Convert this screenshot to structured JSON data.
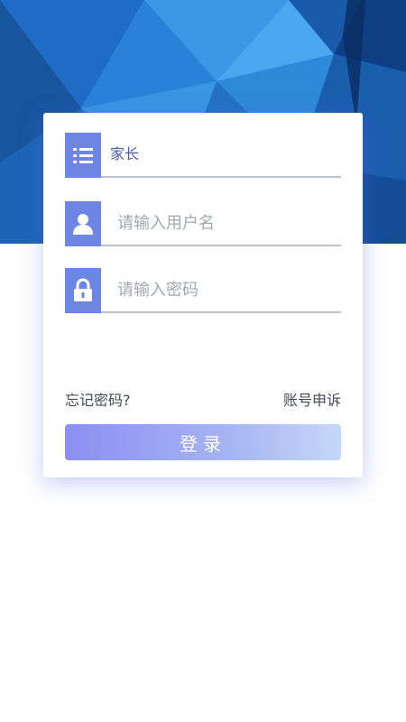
{
  "colors": {
    "icon_bg": "#6d86e3",
    "role_text": "#4a5fa8",
    "button_start": "#8a8ff2",
    "button_end": "#c6d8f7"
  },
  "form": {
    "role_field": {
      "icon": "list-icon",
      "value": "家长"
    },
    "username_field": {
      "icon": "user-icon",
      "placeholder": "请输入用户名"
    },
    "password_field": {
      "icon": "lock-icon",
      "placeholder": "请输入密码"
    }
  },
  "links": {
    "forgot_password": "忘记密码?",
    "account_appeal": "账号申诉"
  },
  "login_button": {
    "label": "登录"
  }
}
